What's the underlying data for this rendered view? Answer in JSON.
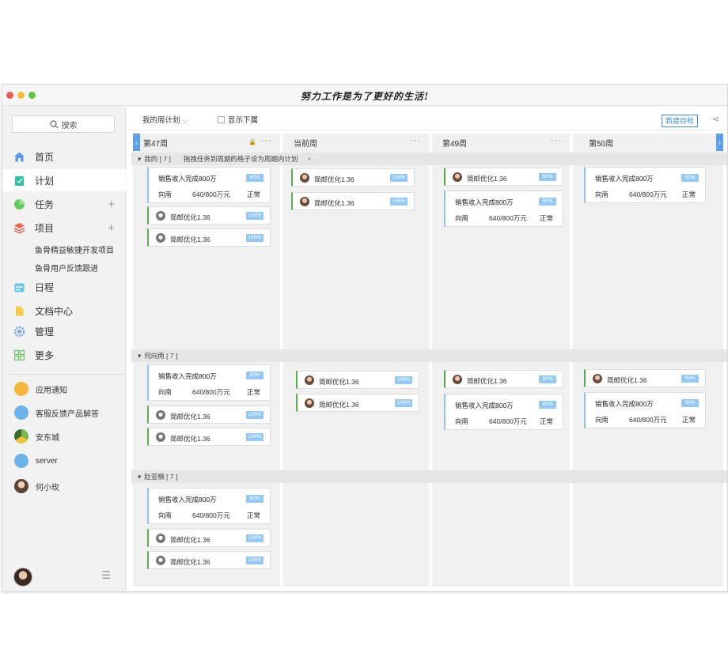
{
  "window": {
    "title": "努力工作是为了更好的生活!"
  },
  "sidebar": {
    "search_label": "搜索",
    "nav": [
      {
        "label": "首页",
        "icon": "home-icon",
        "color": "#5b9be8"
      },
      {
        "label": "计划",
        "icon": "plan-icon",
        "color": "#2ec4a0"
      },
      {
        "label": "任务",
        "icon": "task-icon",
        "color": "#5ccc5c"
      },
      {
        "label": "项目",
        "icon": "project-icon",
        "color": "#f0604e"
      }
    ],
    "projects": [
      "鱼骨精益敏捷开发项目",
      "鱼骨用户反馈跟进"
    ],
    "nav2": [
      {
        "label": "日程",
        "icon": "calendar-icon"
      },
      {
        "label": "文档中心",
        "icon": "document-icon"
      },
      {
        "label": "管理",
        "icon": "gear-icon"
      },
      {
        "label": "更多",
        "icon": "grid-icon"
      }
    ],
    "contacts": [
      "应用通知",
      "客服反馈产品解答",
      "安东城",
      "server",
      "何小玫"
    ]
  },
  "toolbar": {
    "plan_select": "我的周计划",
    "show_sub": "显示下属",
    "new_goal": "新建目标"
  },
  "columns": [
    {
      "title": "第47周"
    },
    {
      "title": "当前周"
    },
    {
      "title": "第49周"
    },
    {
      "title": "第50周"
    }
  ],
  "lanes": [
    {
      "label": "我的 [ 7 ]",
      "hint": "拖拽任务到周期的格子设为周期内计划"
    },
    {
      "label": "何向南 [ 7 ]"
    },
    {
      "label": "赵亚楠 [ 7 ]"
    }
  ],
  "goal": {
    "name": "销售收入完成800万",
    "owner": "向南",
    "amount": "640/800万元",
    "status": "正常",
    "pct": "60%"
  },
  "task": {
    "name": "简邮优化1.36",
    "pct": "100%"
  }
}
